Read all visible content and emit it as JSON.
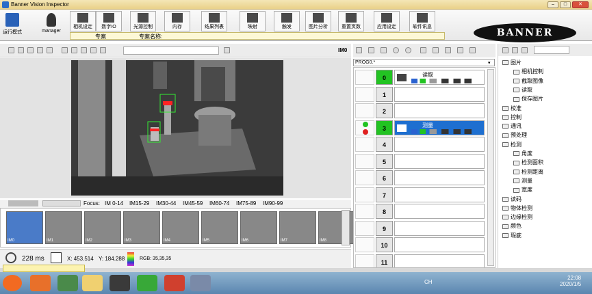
{
  "window": {
    "title": "Banner Vision Inspector"
  },
  "ribbon": {
    "run_mode": "运行模式",
    "user": "manager",
    "buttons": [
      "相机设定",
      "数字IO",
      "光源控制",
      "内存",
      "结果列表",
      "映射",
      "触发",
      "图片分析",
      "重置页数",
      "应用设定",
      "软件讯息"
    ]
  },
  "yellowbar": {
    "project_label": "专案",
    "project_name_label": "专案名称:"
  },
  "logo": "BANNER",
  "image_toolbar": {
    "im_label": "IM0"
  },
  "focus": {
    "label": "Focus:",
    "ranges": [
      "IM 0-14",
      "IM15-29",
      "IM30-44",
      "IM45-59",
      "IM60-74",
      "IM75-89",
      "IM90-99"
    ]
  },
  "thumbnails": [
    "IM0",
    "IM1",
    "IM2",
    "IM3",
    "IM4",
    "IM5",
    "IM6",
    "IM7",
    "IM8"
  ],
  "status": {
    "time": "228 ms",
    "x": "X: 453.514",
    "y": "Y: 184.288",
    "rgb": "RGB: 35,35,35"
  },
  "program": {
    "combo": "PROG0.*",
    "steps": [
      {
        "num": "0",
        "tool": "读取",
        "active": true,
        "selected": false
      },
      {
        "num": "1",
        "tool": "",
        "active": false,
        "selected": false
      },
      {
        "num": "2",
        "tool": "",
        "active": false,
        "selected": false
      },
      {
        "num": "3",
        "tool": "测量",
        "active": true,
        "selected": true
      },
      {
        "num": "4",
        "tool": "",
        "active": false,
        "selected": false
      },
      {
        "num": "5",
        "tool": "",
        "active": false,
        "selected": false
      },
      {
        "num": "6",
        "tool": "",
        "active": false,
        "selected": false
      },
      {
        "num": "7",
        "tool": "",
        "active": false,
        "selected": false
      },
      {
        "num": "8",
        "tool": "",
        "active": false,
        "selected": false
      },
      {
        "num": "9",
        "tool": "",
        "active": false,
        "selected": false
      },
      {
        "num": "10",
        "tool": "",
        "active": false,
        "selected": false
      },
      {
        "num": "11",
        "tool": "",
        "active": false,
        "selected": false
      }
    ]
  },
  "tooltree": {
    "items": [
      "图片",
      "相机控制",
      "截取图像",
      "读取",
      "保存图片",
      "校准",
      "控制",
      "通讯",
      "预处理",
      "检测",
      "角度",
      "检测面积",
      "检测距离",
      "测量",
      "宽度",
      "读码",
      "物体检测",
      "边缘检测",
      "颜色",
      "瑕疵"
    ]
  },
  "taskbar": {
    "ime": "CH",
    "time": "22:08",
    "date": "2020/1/5"
  },
  "colors": {
    "green": "#22c322",
    "select_blue": "#1e6fd0",
    "roi_green": "#33ee33",
    "roi_red": "#ff2222"
  }
}
